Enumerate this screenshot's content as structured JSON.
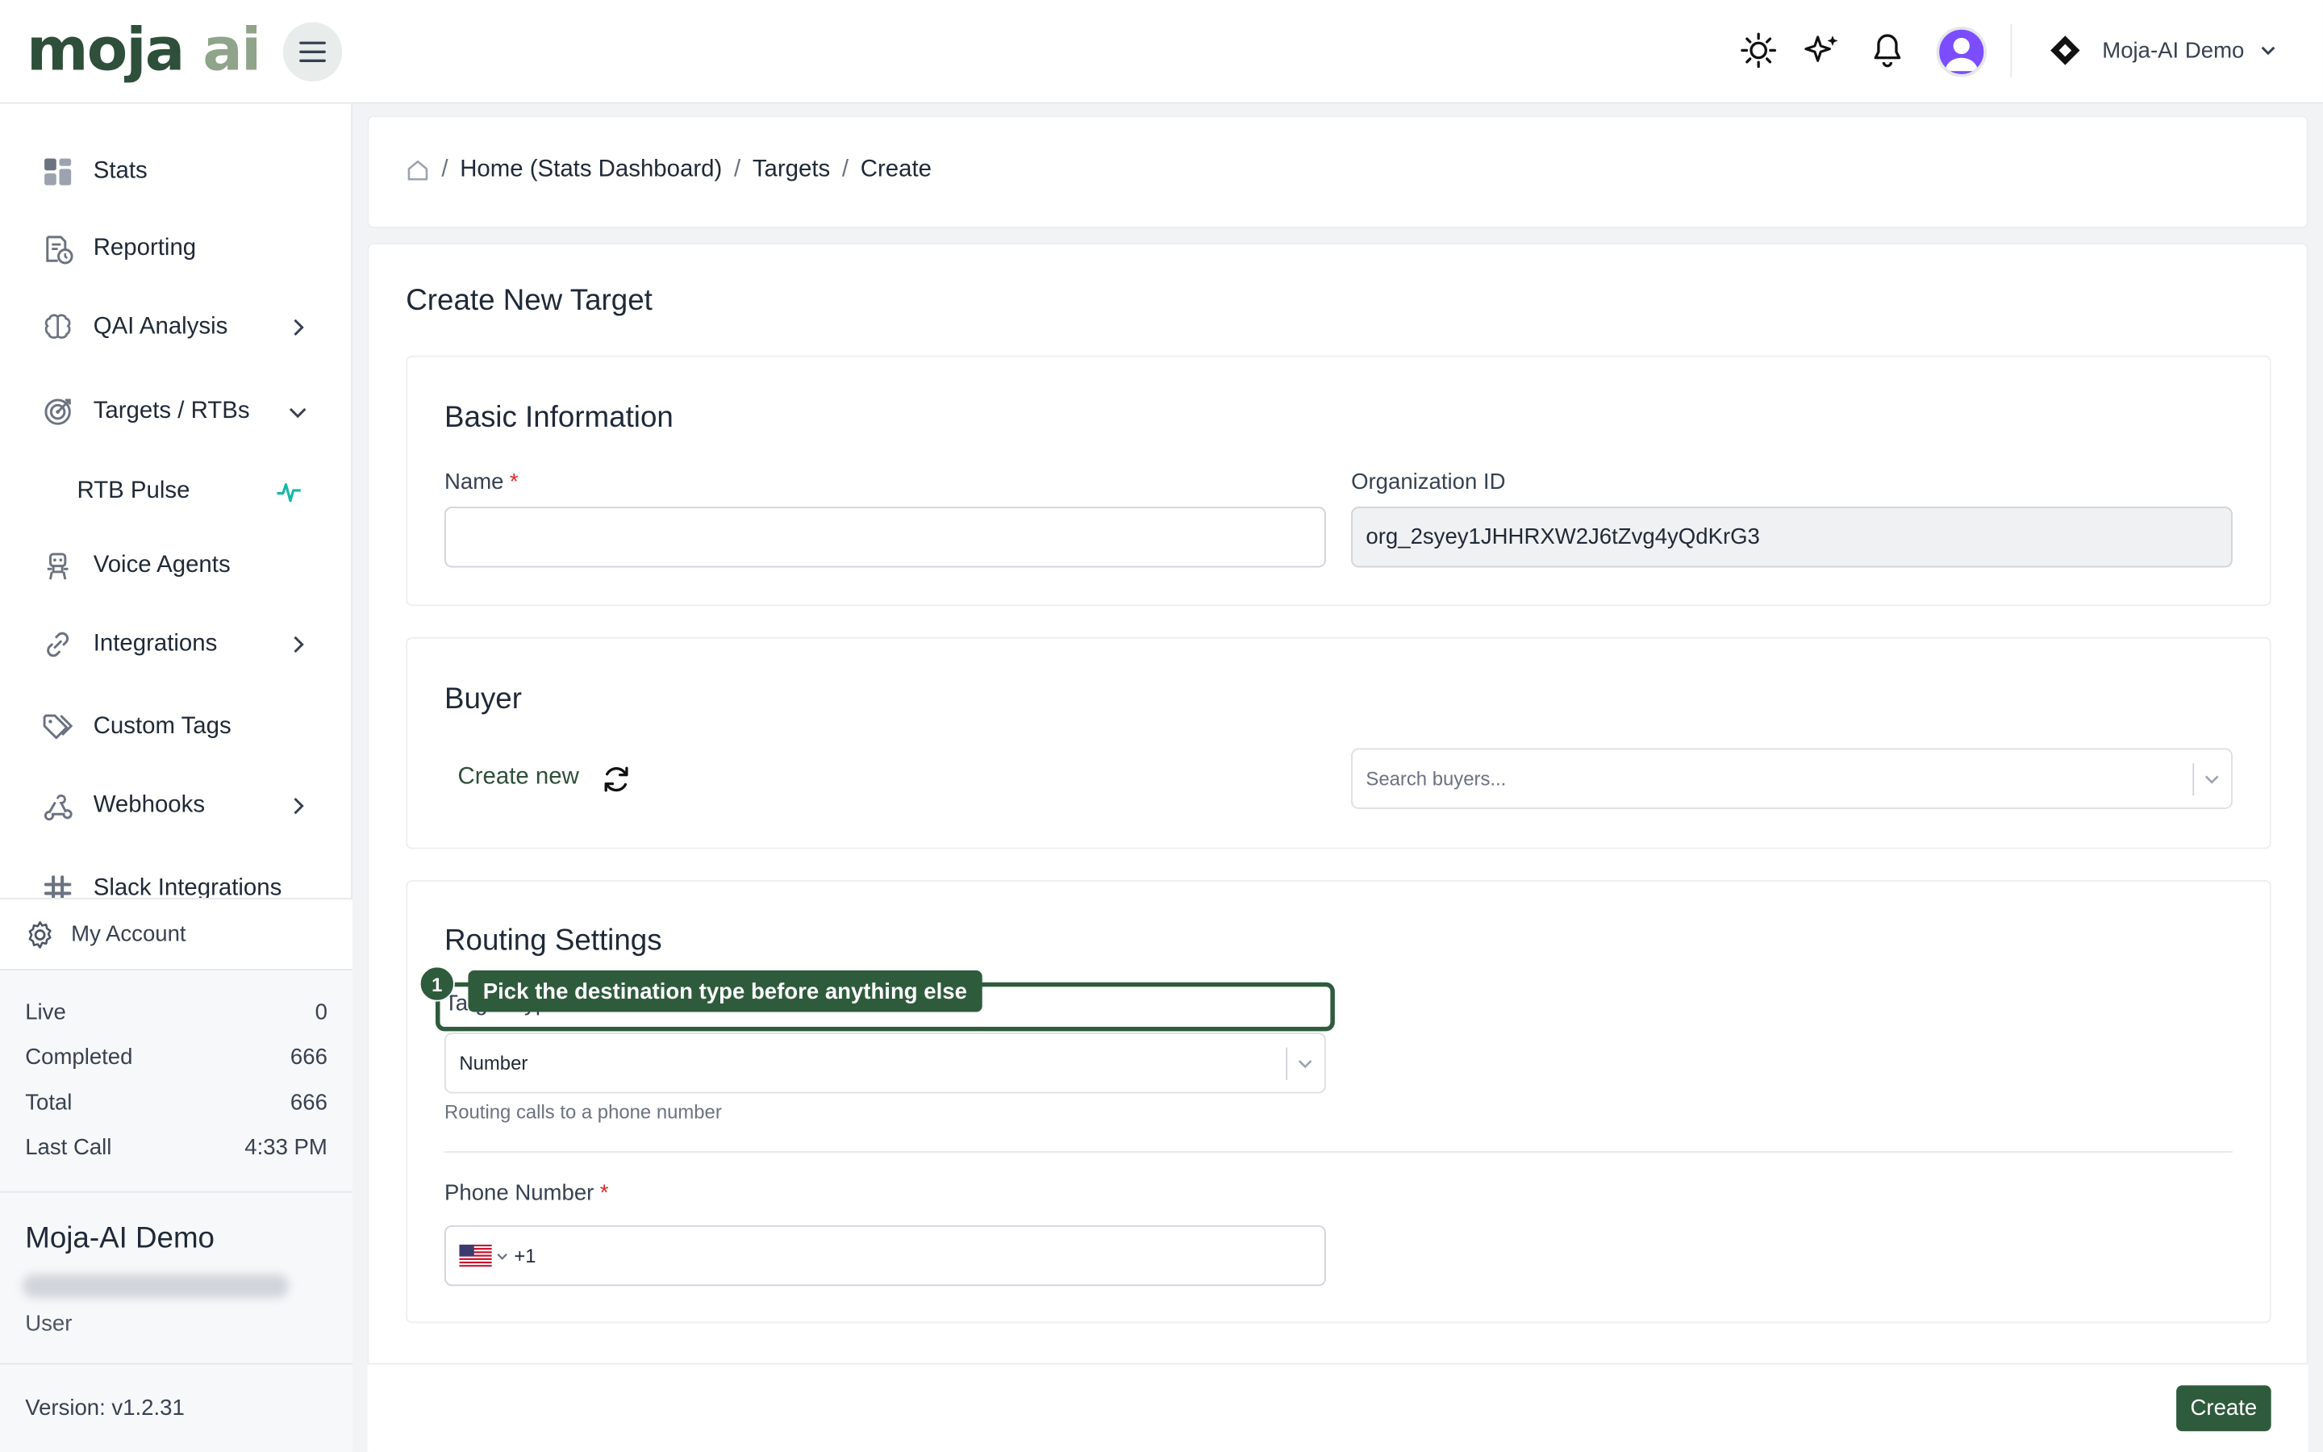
{
  "brand": {
    "logo_part1": "moja",
    "logo_part2": "ai"
  },
  "header": {
    "org_name": "Moja-AI Demo"
  },
  "sidebar": {
    "items": [
      {
        "label": "Stats"
      },
      {
        "label": "Reporting"
      },
      {
        "label": "QAI Analysis"
      },
      {
        "label": "Targets / RTBs"
      },
      {
        "label": "RTB Pulse"
      },
      {
        "label": "Voice Agents"
      },
      {
        "label": "Integrations"
      },
      {
        "label": "Custom Tags"
      },
      {
        "label": "Webhooks"
      },
      {
        "label": "Slack Integrations"
      }
    ],
    "account_label": "My Account",
    "stats": [
      {
        "label": "Live",
        "value": "0"
      },
      {
        "label": "Completed",
        "value": "666"
      },
      {
        "label": "Total",
        "value": "666"
      },
      {
        "label": "Last Call",
        "value": "4:33 PM"
      }
    ],
    "user": {
      "name": "Moja-AI Demo",
      "role": "User"
    },
    "version": "Version: v1.2.31"
  },
  "breadcrumb": {
    "home": "Home (Stats Dashboard)",
    "targets": "Targets",
    "current": "Create",
    "sep": "/"
  },
  "page": {
    "title": "Create New Target"
  },
  "basic": {
    "title": "Basic Information",
    "name_label": "Name",
    "required_mark": "*",
    "org_label": "Organization ID",
    "org_value": "org_2syey1JHHRXW2J6tZvg4yQdKrG3"
  },
  "buyer": {
    "title": "Buyer",
    "create_new": "Create new",
    "search_placeholder": "Search buyers..."
  },
  "routing": {
    "title": "Routing Settings",
    "type_label": "Target Type",
    "type_value": "Number",
    "type_hint": "Routing calls to a phone number",
    "phone_label": "Phone Number",
    "phone_prefix": "+1"
  },
  "callout": {
    "number": "1",
    "text": "Pick the destination type before anything else"
  },
  "actions": {
    "create": "Create"
  }
}
